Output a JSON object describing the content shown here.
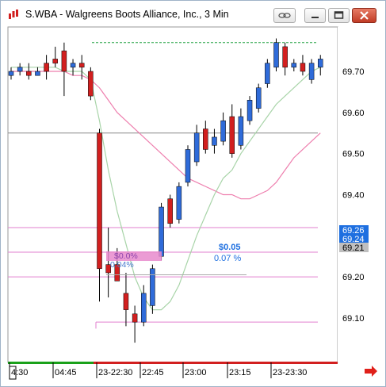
{
  "window": {
    "title": "S.WBA - Walgreens Boots Alliance, Inc., 3 Min",
    "buttons": [
      "link-icon",
      "minimize-icon",
      "maximize-icon",
      "close-icon"
    ]
  },
  "colors": {
    "bull": "#2f6bd9",
    "bear": "#d21f1f",
    "ma_fast": "#a8d4a8",
    "ma_slow": "#ee7fae",
    "level_line": "#e27fcf",
    "price_tag_blue": "#1e6fe0",
    "price_tag_gray": "#bfbfbf",
    "order_bar": "#e889cc",
    "reference_line": "#888888",
    "green_dashed": "#2aa64a"
  },
  "chart_data": {
    "type": "candlestick",
    "symbol": "S.WBA",
    "interval": "3 Min",
    "ylim": [
      69.0,
      69.82
    ],
    "yticks": [
      "69.70",
      "69.60",
      "69.50",
      "69.40",
      "69.30",
      "69.20",
      "69.10"
    ],
    "x_tick_labels": [
      "4:30",
      "04:45",
      "23-22:30",
      "22:45",
      "23:00",
      "23:15",
      "23-23:30"
    ],
    "candles": [
      {
        "o": 69.69,
        "h": 69.71,
        "l": 69.68,
        "c": 69.7
      },
      {
        "o": 69.7,
        "h": 69.72,
        "l": 69.69,
        "c": 69.71
      },
      {
        "o": 69.7,
        "h": 69.72,
        "l": 69.68,
        "c": 69.69
      },
      {
        "o": 69.69,
        "h": 69.71,
        "l": 69.69,
        "c": 69.7
      },
      {
        "o": 69.72,
        "h": 69.74,
        "l": 69.68,
        "c": 69.7
      },
      {
        "o": 69.73,
        "h": 69.76,
        "l": 69.71,
        "c": 69.72
      },
      {
        "o": 69.75,
        "h": 69.77,
        "l": 69.64,
        "c": 69.7
      },
      {
        "o": 69.71,
        "h": 69.73,
        "l": 69.69,
        "c": 69.72
      },
      {
        "o": 69.72,
        "h": 69.74,
        "l": 69.68,
        "c": 69.71
      },
      {
        "o": 69.7,
        "h": 69.71,
        "l": 69.63,
        "c": 69.64
      },
      {
        "o": 69.55,
        "h": 69.56,
        "l": 69.14,
        "c": 69.22
      },
      {
        "o": 69.23,
        "h": 69.32,
        "l": 69.15,
        "c": 69.21
      },
      {
        "o": 69.23,
        "h": 69.27,
        "l": 69.2,
        "c": 69.19
      },
      {
        "o": 69.16,
        "h": 69.21,
        "l": 69.08,
        "c": 69.12
      },
      {
        "o": 69.11,
        "h": 69.13,
        "l": 69.04,
        "c": 69.09
      },
      {
        "o": 69.09,
        "h": 69.18,
        "l": 69.08,
        "c": 69.16
      },
      {
        "o": 69.13,
        "h": 69.23,
        "l": 69.11,
        "c": 69.22
      },
      {
        "o": 69.25,
        "h": 69.38,
        "l": 69.24,
        "c": 69.37
      },
      {
        "o": 69.39,
        "h": 69.4,
        "l": 69.32,
        "c": 69.33
      },
      {
        "o": 69.34,
        "h": 69.43,
        "l": 69.33,
        "c": 69.42
      },
      {
        "o": 69.43,
        "h": 69.52,
        "l": 69.42,
        "c": 69.51
      },
      {
        "o": 69.48,
        "h": 69.57,
        "l": 69.47,
        "c": 69.55
      },
      {
        "o": 69.56,
        "h": 69.58,
        "l": 69.5,
        "c": 69.51
      },
      {
        "o": 69.52,
        "h": 69.56,
        "l": 69.5,
        "c": 69.54
      },
      {
        "o": 69.53,
        "h": 69.6,
        "l": 69.52,
        "c": 69.58
      },
      {
        "o": 69.59,
        "h": 69.62,
        "l": 69.49,
        "c": 69.5
      },
      {
        "o": 69.52,
        "h": 69.61,
        "l": 69.51,
        "c": 69.59
      },
      {
        "o": 69.58,
        "h": 69.64,
        "l": 69.57,
        "c": 69.63
      },
      {
        "o": 69.61,
        "h": 69.67,
        "l": 69.6,
        "c": 69.66
      },
      {
        "o": 69.67,
        "h": 69.73,
        "l": 69.66,
        "c": 69.72
      },
      {
        "o": 69.71,
        "h": 69.78,
        "l": 69.7,
        "c": 69.77
      },
      {
        "o": 69.76,
        "h": 69.77,
        "l": 69.69,
        "c": 69.71
      },
      {
        "o": 69.71,
        "h": 69.73,
        "l": 69.7,
        "c": 69.72
      },
      {
        "o": 69.72,
        "h": 69.74,
        "l": 69.69,
        "c": 69.7
      },
      {
        "o": 69.68,
        "h": 69.73,
        "l": 69.67,
        "c": 69.72
      },
      {
        "o": 69.71,
        "h": 69.74,
        "l": 69.69,
        "c": 69.73
      }
    ],
    "ma_fast": [
      69.71,
      69.71,
      69.71,
      69.71,
      69.71,
      69.71,
      69.7,
      69.7,
      69.7,
      69.68,
      69.58,
      69.46,
      69.36,
      69.28,
      69.2,
      69.15,
      69.12,
      69.12,
      69.14,
      69.18,
      69.24,
      69.3,
      69.35,
      69.4,
      69.44,
      69.46,
      69.5,
      69.53,
      69.56,
      69.59,
      69.62,
      69.64,
      69.66,
      69.68,
      69.7,
      69.71
    ],
    "ma_slow": [
      69.7,
      69.7,
      69.7,
      69.7,
      69.7,
      69.7,
      69.7,
      69.69,
      69.69,
      69.68,
      69.66,
      69.63,
      69.6,
      69.58,
      69.56,
      69.54,
      69.52,
      69.5,
      69.48,
      69.46,
      69.44,
      69.43,
      69.42,
      69.41,
      69.4,
      69.4,
      69.39,
      69.39,
      69.4,
      69.41,
      69.43,
      69.46,
      69.49,
      69.51,
      69.53,
      69.55
    ],
    "levels": [
      {
        "value": 69.77,
        "style": "green-dashed"
      },
      {
        "value": 69.55,
        "style": "gray-solid"
      },
      {
        "value": 69.32,
        "style": "pink-solid"
      },
      {
        "value": 69.26,
        "style": "pink-solid"
      },
      {
        "value": 69.2,
        "style": "pink-solid"
      },
      {
        "value": 69.09,
        "style": "pink-solid"
      }
    ],
    "price_tags": [
      {
        "value": 69.26,
        "label": "69.26",
        "style": "blue"
      },
      {
        "value": 69.24,
        "label": "69.24",
        "style": "blue"
      },
      {
        "value": 69.21,
        "label": "69.21",
        "style": "gray"
      }
    ],
    "order": {
      "pl_label": "$0.05",
      "pct_label": "0.07 %",
      "ghost_pl_label": "$0.0%",
      "ghost_pct_label": "0.04%"
    }
  }
}
